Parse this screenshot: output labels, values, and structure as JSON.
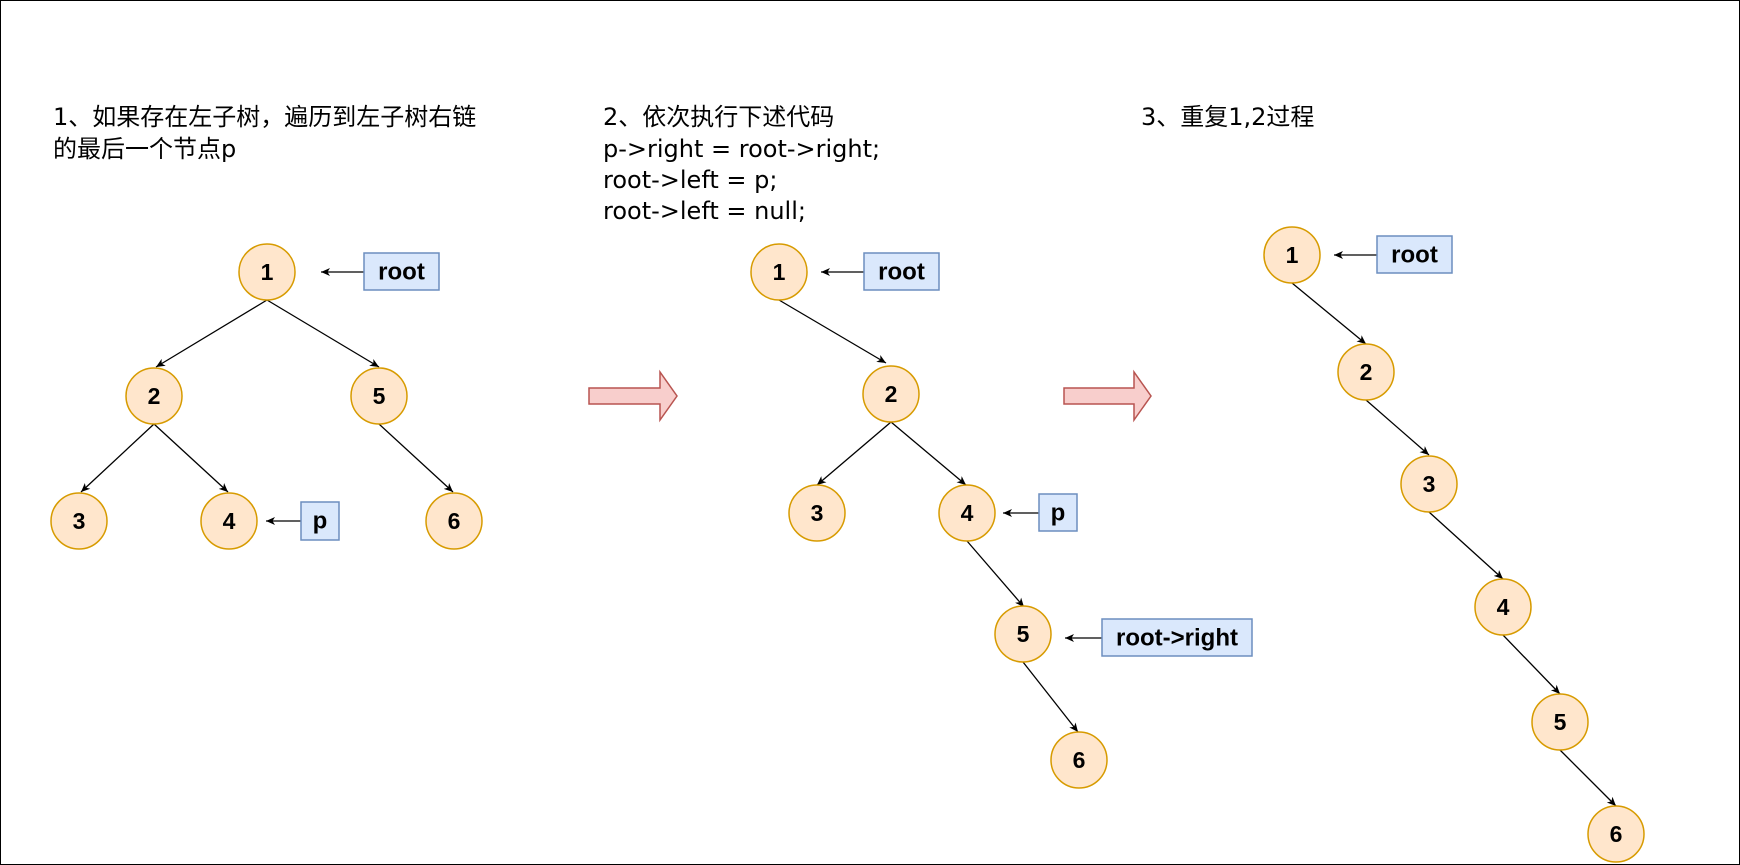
{
  "steps": {
    "step1": {
      "line1": "1、如果存在左子树，遍历到左子树右链",
      "line2": "的最后一个节点p"
    },
    "step2": {
      "line1": "2、依次执行下述代码",
      "code1": "p->right = root->right;",
      "code2": "root->left = p;",
      "code3": "root->left = null;"
    },
    "step3": {
      "line1": "3、重复1,2过程"
    }
  },
  "tree1": {
    "nodes": [
      "1",
      "2",
      "5",
      "3",
      "4",
      "6"
    ],
    "tags": {
      "root": "root",
      "p": "p"
    }
  },
  "tree2": {
    "nodes": [
      "1",
      "2",
      "3",
      "4",
      "5",
      "6"
    ],
    "tags": {
      "root": "root",
      "p": "p",
      "root_right": "root->right"
    }
  },
  "tree3": {
    "nodes": [
      "1",
      "2",
      "3",
      "4",
      "5",
      "6"
    ],
    "tags": {
      "root": "root"
    }
  },
  "colors": {
    "node_fill": "#ffe6cc",
    "node_stroke": "#d79b00",
    "tag_fill": "#dae8fc",
    "tag_stroke": "#6c8ebf",
    "arrow_fill": "#f8cecc",
    "arrow_stroke": "#b85450"
  }
}
